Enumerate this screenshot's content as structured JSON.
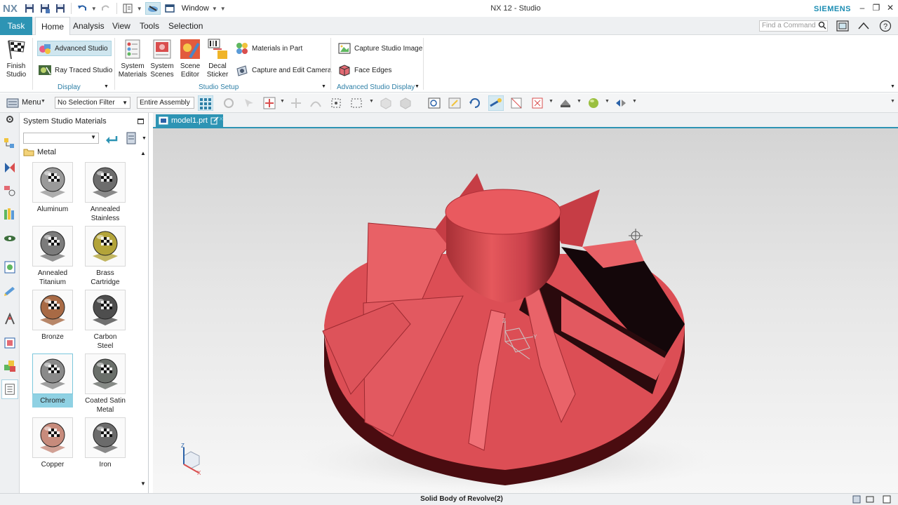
{
  "app": {
    "logo": "NX",
    "window_menu": "Window",
    "title": "NX 12 - Studio",
    "brand": "SIEMENS"
  },
  "ribbon_tabs": [
    "Task",
    "Home",
    "Analysis",
    "View",
    "Tools",
    "Selection"
  ],
  "find_command": {
    "placeholder": "Find a Command"
  },
  "ribbon": {
    "finish_studio": "Finish\nStudio",
    "advanced_studio": "Advanced Studio",
    "ray_traced_studio": "Ray Traced Studio",
    "display_group": "Display",
    "system_materials": "System\nMaterials",
    "system_scenes": "System\nScenes",
    "scene_editor": "Scene\nEditor",
    "decal_sticker": "Decal\nSticker",
    "materials_in_part": "Materials in Part",
    "capture_edit_camera": "Capture and Edit Camera",
    "studio_setup_group": "Studio Setup",
    "capture_studio_image": "Capture Studio Image",
    "face_edges": "Face Edges",
    "advanced_display_group": "Advanced Studio Display"
  },
  "toolbar": {
    "menu": "Menu",
    "selection_filter": "No Selection Filter",
    "assembly_scope": "Entire Assembly"
  },
  "panel": {
    "title": "System Studio Materials",
    "folder": "Metal",
    "materials": [
      {
        "name": "Aluminum",
        "color": "#9a9a9a",
        "selected": false
      },
      {
        "name": "Annealed Stainless",
        "color": "#6d6d6d",
        "selected": false
      },
      {
        "name": "Annealed Titanium",
        "color": "#7b7b7b",
        "selected": false
      },
      {
        "name": "Brass Cartridge",
        "color": "#b3a43a",
        "selected": false
      },
      {
        "name": "Bronze",
        "color": "#a86a45",
        "selected": false
      },
      {
        "name": "Carbon Steel",
        "color": "#4e4e4e",
        "selected": false
      },
      {
        "name": "Chrome",
        "color": "#8a8a8a",
        "selected": true
      },
      {
        "name": "Coated Satin Metal",
        "color": "#6a6f6a",
        "selected": false
      },
      {
        "name": "Copper",
        "color": "#c78b7c",
        "selected": false
      },
      {
        "name": "Iron",
        "color": "#6b6b6b",
        "selected": false
      }
    ]
  },
  "document": {
    "tab": "model1.prt"
  },
  "viewport": {
    "model_color": "#e5585c",
    "triad_labels": [
      "Z",
      "Y",
      "X"
    ]
  },
  "status": {
    "text": "Solid Body of Revolve(2)"
  }
}
